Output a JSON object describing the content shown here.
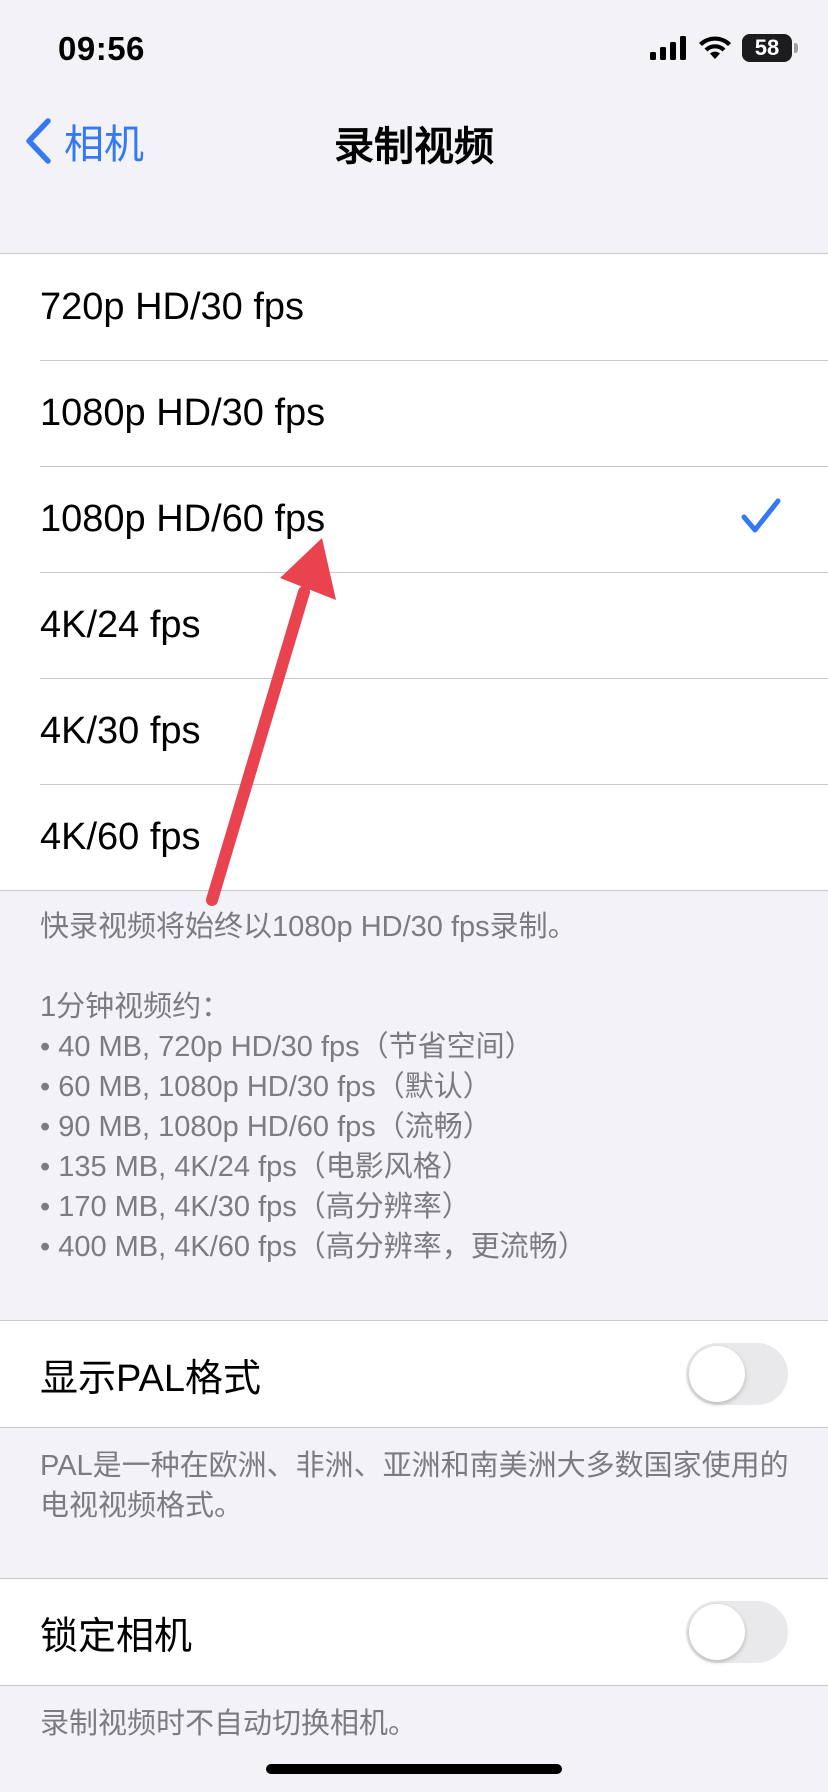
{
  "status_bar": {
    "time": "09:56",
    "battery_level": "58"
  },
  "nav": {
    "back_label": "相机",
    "title": "录制视频"
  },
  "formats": [
    {
      "label": "720p HD/30 fps",
      "selected": false
    },
    {
      "label": "1080p HD/30 fps",
      "selected": false
    },
    {
      "label": "1080p HD/60 fps",
      "selected": true
    },
    {
      "label": "4K/24 fps",
      "selected": false
    },
    {
      "label": "4K/30 fps",
      "selected": false
    },
    {
      "label": "4K/60 fps",
      "selected": false
    }
  ],
  "format_footer": {
    "quick_take": "快录视频将始终以1080p HD/30 fps录制。",
    "size_header": "1分钟视频约：",
    "sizes": [
      "• 40 MB, 720p HD/30 fps（节省空间）",
      "• 60 MB, 1080p HD/30 fps（默认）",
      "• 90 MB, 1080p HD/60 fps（流畅）",
      "• 135 MB, 4K/24 fps（电影风格）",
      "• 170 MB, 4K/30 fps（高分辨率）",
      "• 400 MB, 4K/60 fps（高分辨率，更流畅）"
    ]
  },
  "pal": {
    "label": "显示PAL格式",
    "enabled": false,
    "footer": "PAL是一种在欧洲、非洲、亚洲和南美洲大多数国家使用的电视视频格式。"
  },
  "lock_camera": {
    "label": "锁定相机",
    "enabled": false,
    "footer": "录制视频时不自动切换相机。"
  },
  "colors": {
    "accent": "#3478f6",
    "annotation_arrow": "#e8434f",
    "background": "#f2f2f7"
  }
}
